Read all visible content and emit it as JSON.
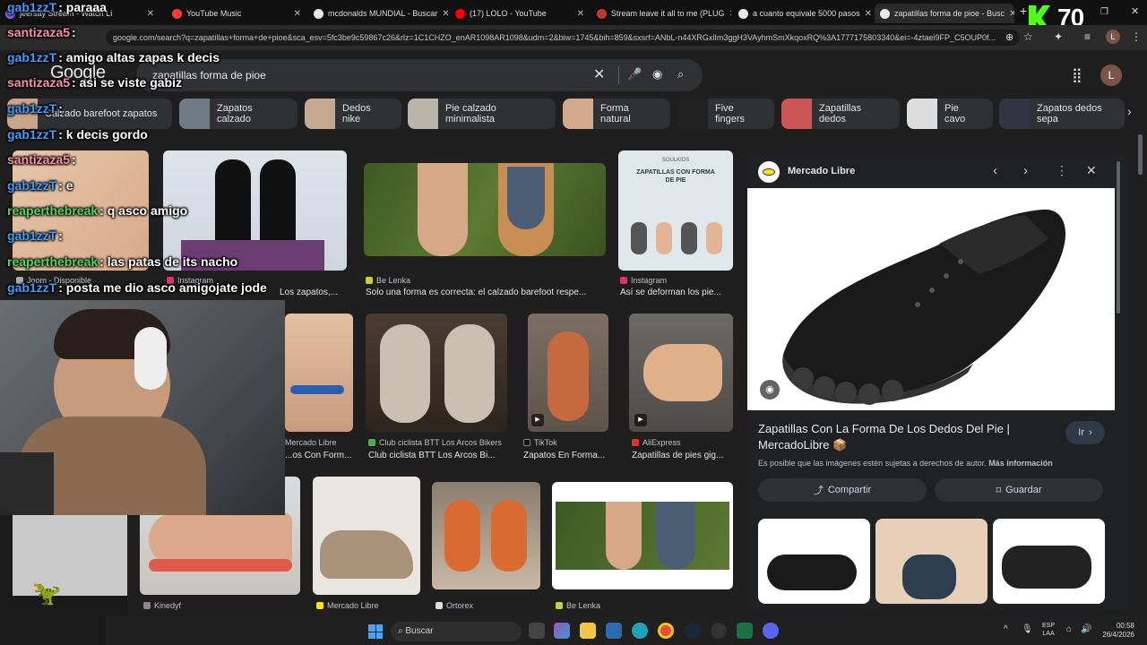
{
  "tabs": [
    {
      "label": "jeersay Stream - Watch Li",
      "color": "#8a5cf6"
    },
    {
      "label": "YouTube Music",
      "color": "#ff3b30"
    },
    {
      "label": "mcdonalds MUNDIAL - Buscar",
      "color": "#e8e8e8"
    },
    {
      "label": "(17) LOLO - YouTube",
      "color": "#ff0000"
    },
    {
      "label": "Stream leave it all to me (PLUG",
      "color": "#c0392b"
    },
    {
      "label": "a cuanto equivale 5000 pasos",
      "color": "#e8e8e8"
    },
    {
      "label": "zapatillas forma de pioe - Busc",
      "color": "#e8e8e8"
    }
  ],
  "address_bar": {
    "url": "google.com/search?q=zapatillas+forma+de+pioe&sca_esv=5fc3be9c59867c26&rlz=1C1CHZO_enAR1098AR1098&udm=2&biw=1745&bih=859&sxsrf=ANbL-n44XRGxlIm3ggH3VAyhmSmXkqoxRQ%3A1777175803340&ei=-4ztaei9FP_C5OUP0f..."
  },
  "google": {
    "logo": "Google",
    "query": "zapatillas forma de pioe",
    "avatar": "L"
  },
  "kick": {
    "count": "70"
  },
  "chips": [
    "Calzado barefoot zapatos",
    "Zapatos calzado",
    "Dedos nike",
    "Pie calzado minimalista",
    "Forma natural",
    "Five fingers",
    "Zapatillas dedos",
    "Pie cavo",
    "Zapatos dedos sepa"
  ],
  "results": [
    {
      "source": "Joom - Disponible",
      "caption": ""
    },
    {
      "source": "Instagram",
      "caption": "Los zapatos,..."
    },
    {
      "source": "Be Lenka",
      "caption": "Solo una forma es correcta: el calzado barefoot respe..."
    },
    {
      "source": "Instagram",
      "caption": "Así se deforman los pie..."
    },
    {
      "source": "Mercado Libre",
      "caption": "...os Con Form..."
    },
    {
      "source": "Club ciclista BTT Los Arcos Bikers",
      "caption": "Club ciclista BTT Los Arcos Bi..."
    },
    {
      "source": "TikTok",
      "caption": "Zapatos En Forma..."
    },
    {
      "source": "AliExpress",
      "caption": "Zapatillas de pies gig..."
    },
    {
      "source": "Kinedyf",
      "caption": ""
    },
    {
      "source": "Mercado Libre",
      "caption": ""
    },
    {
      "source": "Ortorex",
      "caption": ""
    },
    {
      "source": "Be Lenka",
      "caption": ""
    }
  ],
  "instagram_card": {
    "brand": "SOULKIDS",
    "title": "ZAPATILLAS CON FORMA DE PIE"
  },
  "panel": {
    "source": "Mercado Libre",
    "title": "Zapatillas Con La Forma De Los Dedos Del Pie | MercadoLibre 📦",
    "go_label": "Ir",
    "notice": "Es posible que las imágenes estén sujetas a derechos de autor.",
    "more_info": "Más información",
    "share_label": "Compartir",
    "save_label": "Guardar"
  },
  "chat": [
    {
      "user": "gab1zzT",
      "msg": ": paraaa",
      "color": "#3aa0ff"
    },
    {
      "user": "santizaza5",
      "msg": ":",
      "color": "#ff8fa8"
    },
    {
      "user": "gab1zzT",
      "msg": ": amigo altas zapas k decis",
      "color": "#3aa0ff"
    },
    {
      "user": "santizaza5",
      "msg": ": asi se viste gabiz",
      "color": "#ff8fa8"
    },
    {
      "user": "gab1zzT",
      "msg": ":",
      "color": "#3aa0ff"
    },
    {
      "user": "gab1zzT",
      "msg": ": k decis gordo",
      "color": "#3aa0ff"
    },
    {
      "user": "santizaza5",
      "msg": ":",
      "color": "#ff8fa8"
    },
    {
      "user": "gab1zzT",
      "msg": ": e",
      "color": "#3aa0ff"
    },
    {
      "user": "reaperthebreak",
      "msg": ": q asco amigo",
      "color": "#4cd964"
    },
    {
      "user": "gab1zzT",
      "msg": ":",
      "color": "#3aa0ff"
    },
    {
      "user": "reaperthebreak",
      "msg": ": las patas de its nacho",
      "color": "#4cd964"
    },
    {
      "user": "gab1zzT",
      "msg": ": posta me dio asco amigojate jode",
      "color": "#3aa0ff"
    }
  ],
  "taskbar": {
    "search_placeholder": "Buscar",
    "lang": "ESP",
    "lang2": "LAA",
    "time": "00:58",
    "date": "26/4/2026"
  }
}
